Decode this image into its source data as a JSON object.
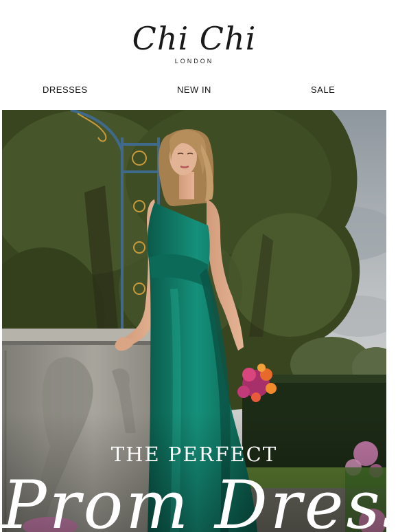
{
  "brand": {
    "name": "Chi Chi",
    "tagline": "LONDON"
  },
  "nav": {
    "items": [
      {
        "label": "DRESSES"
      },
      {
        "label": "NEW IN"
      },
      {
        "label": "SALE"
      }
    ]
  },
  "hero": {
    "heading": "THE PERFECT",
    "script_text": "Prom Dress",
    "colors": {
      "dress": "#0f7a66",
      "foliage": "#3c4a22",
      "sky": "#b8bcc0",
      "stone": "#9a9890",
      "gate": "#3f6a8c"
    }
  }
}
